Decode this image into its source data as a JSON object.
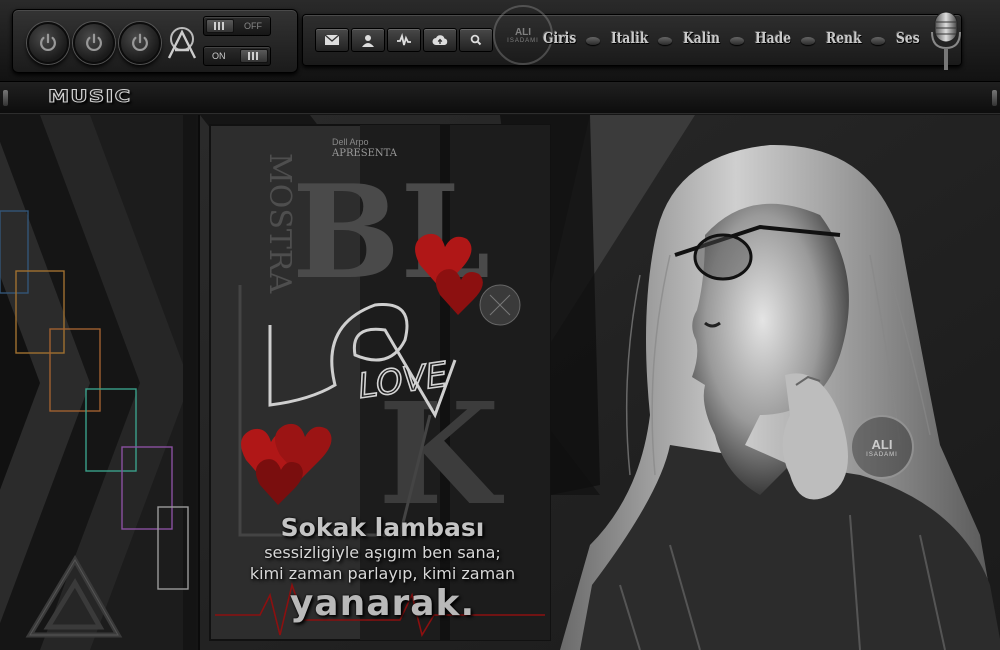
{
  "toolbar": {
    "power_buttons": [
      "power-icon",
      "power-icon",
      "power-icon"
    ],
    "toggle_off_label": "OFF",
    "toggle_on_label": "ON",
    "icon_buttons": [
      "mail-icon",
      "user-icon",
      "waveform-icon",
      "cloud-upload-icon",
      "search-icon"
    ]
  },
  "watermark": {
    "name": "ALI",
    "sub": "ISADAMI"
  },
  "nav": [
    "Giris",
    "Italik",
    "Kalin",
    "Hade",
    "Renk",
    "Ses"
  ],
  "strip": {
    "title": "MUSIC"
  },
  "poster": {
    "letters": "BL",
    "sideword": "MOSTRA",
    "brand_top": "Dell Arpo",
    "brand_sub": "APRESENTA",
    "love": "LOVE",
    "k": "K"
  },
  "poem": {
    "title": "Sokak lambası",
    "line1": "sessizligiyle aşıgım ben sana;",
    "line2": "kimi zaman parlayıp, kimi zaman",
    "end": "yanarak."
  },
  "colors": {
    "accent_red": "#b01717",
    "steel": "#c9c9c9"
  }
}
